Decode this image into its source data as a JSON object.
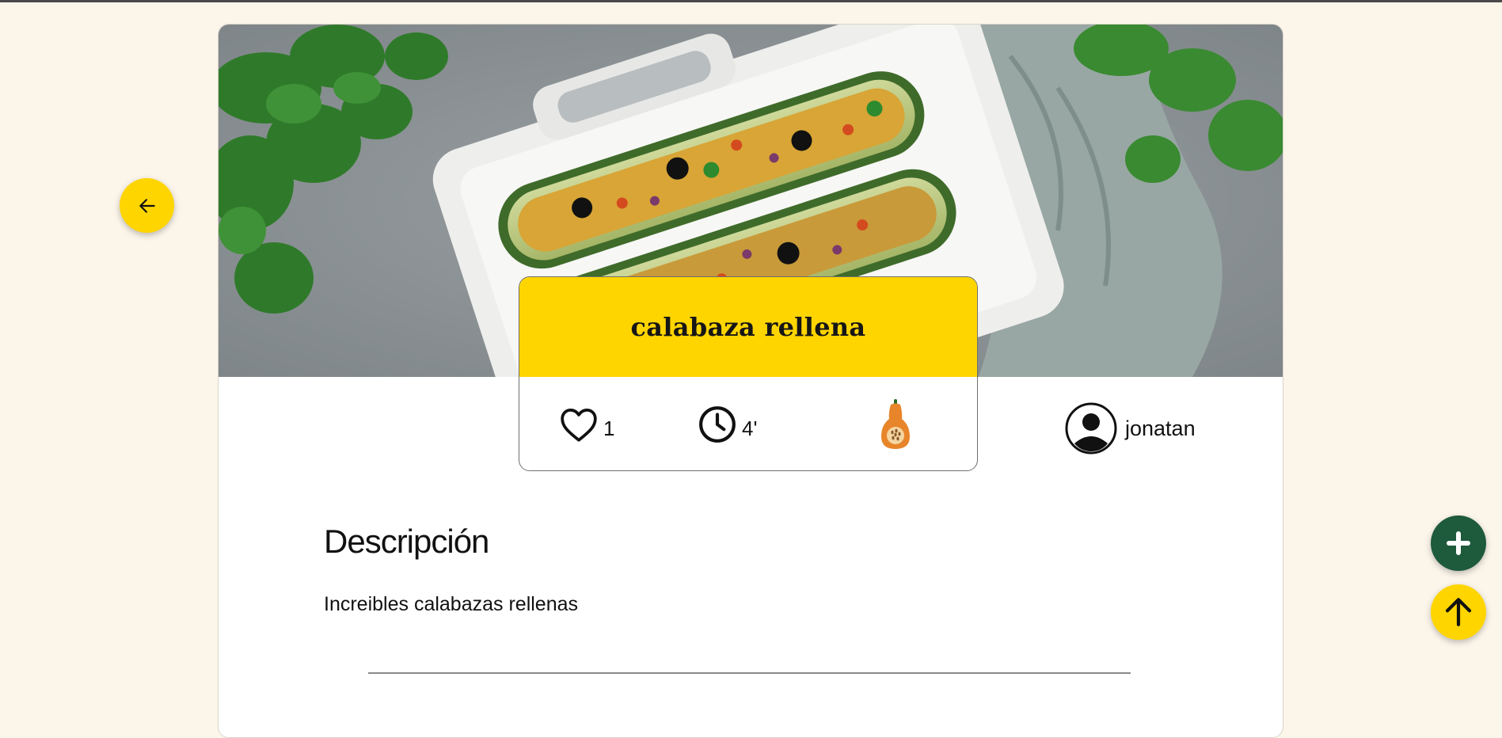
{
  "recipe": {
    "title": "calabaza rellena",
    "likes": "1",
    "time": "4'",
    "category_icon": "butternut-squash-icon",
    "image_alt": "stuffed zucchini on white baking dish"
  },
  "author": {
    "name": "jonatan",
    "avatar_icon": "user-avatar-icon"
  },
  "description": {
    "heading": "Descripción",
    "text": "Increibles calabazas rellenas"
  },
  "buttons": {
    "back_icon": "arrow-left-icon",
    "add_icon": "plus-icon",
    "top_icon": "arrow-up-icon"
  },
  "colors": {
    "accent_yellow": "#ffd500",
    "accent_green": "#1e5a3c",
    "page_bg": "#fbf5ea"
  }
}
